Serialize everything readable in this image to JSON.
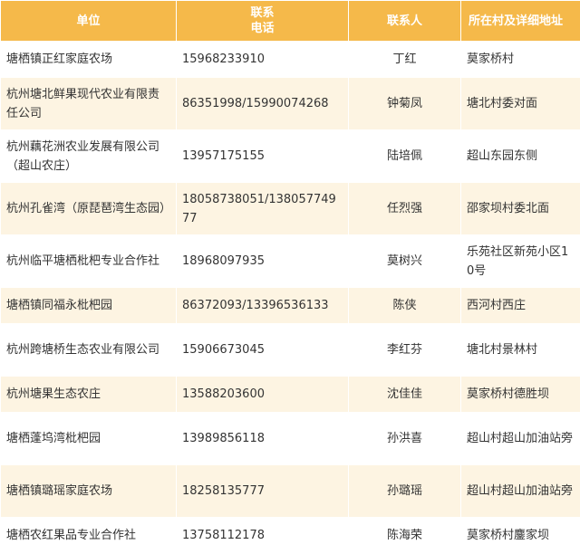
{
  "table": {
    "headers": {
      "unit": "单位",
      "phone": "联系\n电话",
      "contact": "联系人",
      "address": "所在村及详细地址"
    },
    "rows": [
      {
        "unit": "塘栖镇正红家庭农场",
        "phone": "15968233910",
        "contact": "丁红",
        "address": "莫家桥村"
      },
      {
        "unit": "杭州塘北鲜果现代农业有限责任公司",
        "phone": "86351998/15990074268",
        "contact": "钟菊凤",
        "address": "塘北村委对面"
      },
      {
        "unit": "杭州藕花洲农业发展有限公司（超山农庄）",
        "phone": "13957175155",
        "contact": "陆培佩",
        "address": "超山东园东侧"
      },
      {
        "unit": "杭州孔雀湾（原琵琶湾生态园）",
        "phone": "18058738051/13805774977",
        "contact": "任烈强",
        "address": "邵家坝村委北面"
      },
      {
        "unit": "杭州临平塘栖枇杷专业合作社",
        "phone": "18968097935",
        "contact": "莫树兴",
        "address": "乐苑社区新苑小区10号"
      },
      {
        "unit": "塘栖镇同福永枇杷园",
        "phone": "86372093/13396536133",
        "contact": "陈侠",
        "address": "西河村西庄"
      },
      {
        "unit": "杭州跨塘桥生态农业有限公司",
        "phone": "15906673045",
        "contact": "李红芬",
        "address": "塘北村景林村"
      },
      {
        "unit": "杭州塘果生态农庄",
        "phone": "13588203600",
        "contact": "沈佳佳",
        "address": "莫家桥村德胜坝"
      },
      {
        "unit": "塘栖蓬坞湾枇杷园",
        "phone": "13989856118",
        "contact": "孙洪喜",
        "address": "超山村超山加油站旁"
      },
      {
        "unit": "塘栖镇璐瑶家庭农场",
        "phone": "18258135777",
        "contact": "孙璐瑶",
        "address": "超山村超山加油站旁"
      },
      {
        "unit": "塘栖农红果品专业合作社",
        "phone": "13758112178",
        "contact": "陈海荣",
        "address": "莫家桥村鏖家坝"
      }
    ]
  }
}
